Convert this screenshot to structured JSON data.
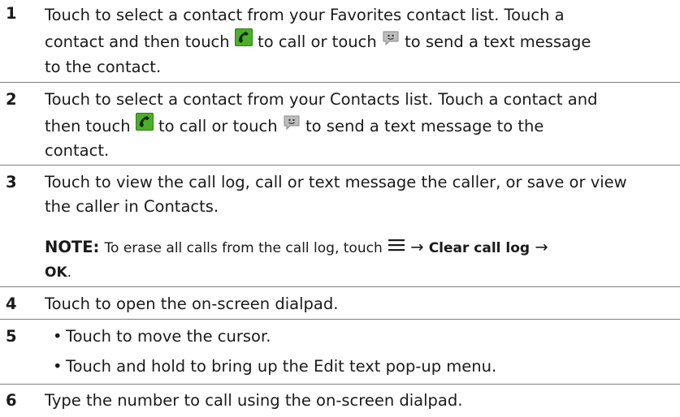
{
  "rows": [
    {
      "number": "1",
      "line1": "Touch to select a contact from your Favorites contact list. Touch a",
      "line2_a": "contact and then touch",
      "line2_b": "to call or touch",
      "line2_c": "to send a text message",
      "line3": "to the contact."
    },
    {
      "number": "2",
      "line1": "Touch to select a contact from your Contacts list. Touch a contact and",
      "line2_a": "then touch",
      "line2_b": "to call or touch",
      "line2_c": "to send a text message to the",
      "line3": "contact."
    },
    {
      "number": "3",
      "line1": "Touch to view the call log, call or text message the caller, or save or view",
      "line2": "the caller in Contacts.",
      "note_label": "NOTE:",
      "note_text": "To erase all calls from the call log, touch",
      "note_arrow1": "→",
      "note_clear": "Clear call log",
      "note_arrow2": "→",
      "note_ok": "OK",
      "note_period": "."
    },
    {
      "number": "4",
      "line1": "Touch to open the on-screen dialpad."
    },
    {
      "number": "5",
      "bullet1": "Touch to move the cursor.",
      "bullet2": "Touch and hold to bring up the Edit text pop-up menu.",
      "bullet_char": "•"
    },
    {
      "number": "6",
      "line1": "Type the number to call using the on-screen dialpad."
    }
  ],
  "icons": {
    "phone": "phone-icon",
    "sms": "sms-icon",
    "menu": "menu-icon"
  },
  "colors": {
    "text": "#1a1a1a",
    "rule": "#7f7f7f",
    "phone_green": "#3f9e1f"
  }
}
